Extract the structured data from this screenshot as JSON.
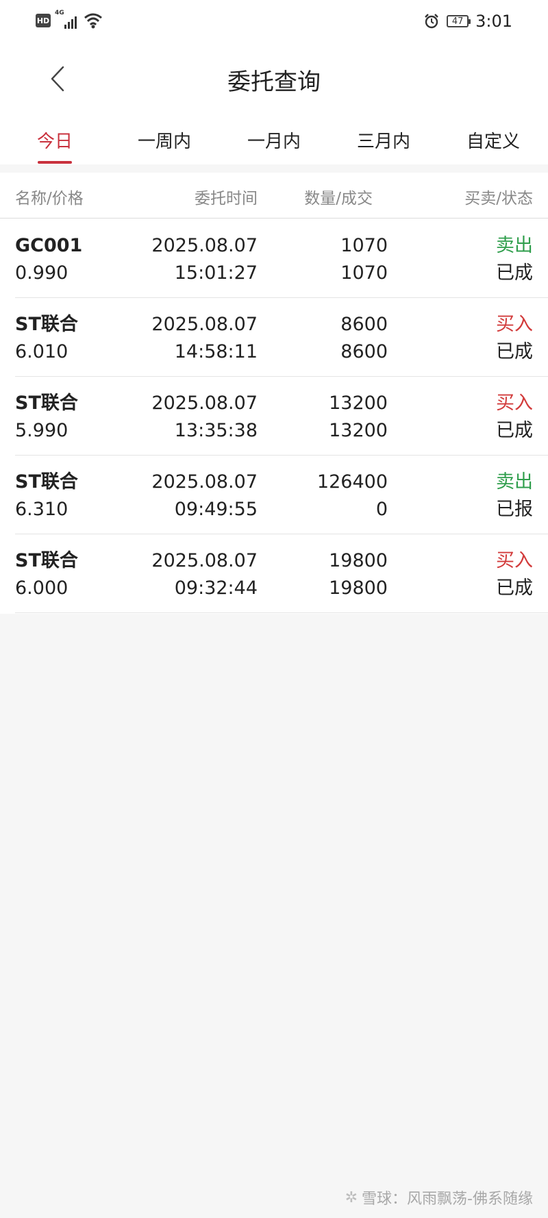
{
  "status_bar": {
    "hd": "HD",
    "network": "4G",
    "battery": "47",
    "time": "3:01"
  },
  "header": {
    "title": "委托查询"
  },
  "tabs": [
    {
      "label": "今日",
      "active": true
    },
    {
      "label": "一周内",
      "active": false
    },
    {
      "label": "一月内",
      "active": false
    },
    {
      "label": "三月内",
      "active": false
    },
    {
      "label": "自定义",
      "active": false
    }
  ],
  "columns": {
    "name_price": "名称/价格",
    "time": "委托时间",
    "qty": "数量/成交",
    "side_status": "买卖/状态"
  },
  "orders": [
    {
      "name": "GC001",
      "price": "0.990",
      "date": "2025.08.07",
      "time": "15:01:27",
      "qty": "1070",
      "filled": "1070",
      "side": "卖出",
      "status": "已成"
    },
    {
      "name": "ST联合",
      "price": "6.010",
      "date": "2025.08.07",
      "time": "14:58:11",
      "qty": "8600",
      "filled": "8600",
      "side": "买入",
      "status": "已成"
    },
    {
      "name": "ST联合",
      "price": "5.990",
      "date": "2025.08.07",
      "time": "13:35:38",
      "qty": "13200",
      "filled": "13200",
      "side": "买入",
      "status": "已成"
    },
    {
      "name": "ST联合",
      "price": "6.310",
      "date": "2025.08.07",
      "time": "09:49:55",
      "qty": "126400",
      "filled": "0",
      "side": "卖出",
      "status": "已报"
    },
    {
      "name": "ST联合",
      "price": "6.000",
      "date": "2025.08.07",
      "time": "09:32:44",
      "qty": "19800",
      "filled": "19800",
      "side": "买入",
      "status": "已成"
    }
  ],
  "watermark": "雪球：风雨飘荡-佛系随缘",
  "colors": {
    "accent": "#c9313d",
    "sell": "#2f9e4c",
    "buy": "#d23b3b"
  }
}
